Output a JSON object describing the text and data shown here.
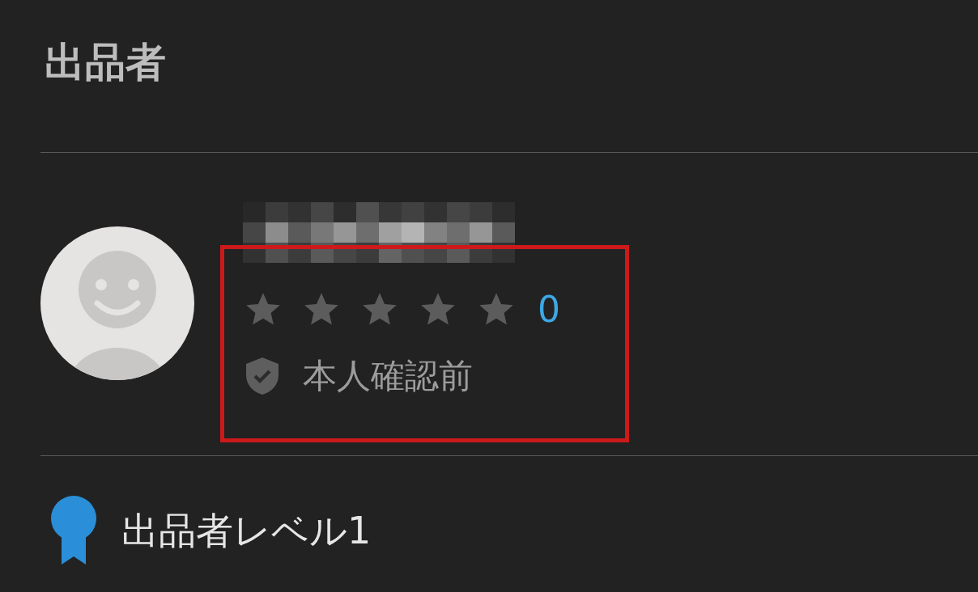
{
  "section_title": "出品者",
  "seller": {
    "name_hidden": true,
    "stars": 0,
    "rating_count": "0",
    "verification": "本人確認前",
    "verified": false
  },
  "highlight": true,
  "level": {
    "label": "出品者レベル1"
  }
}
